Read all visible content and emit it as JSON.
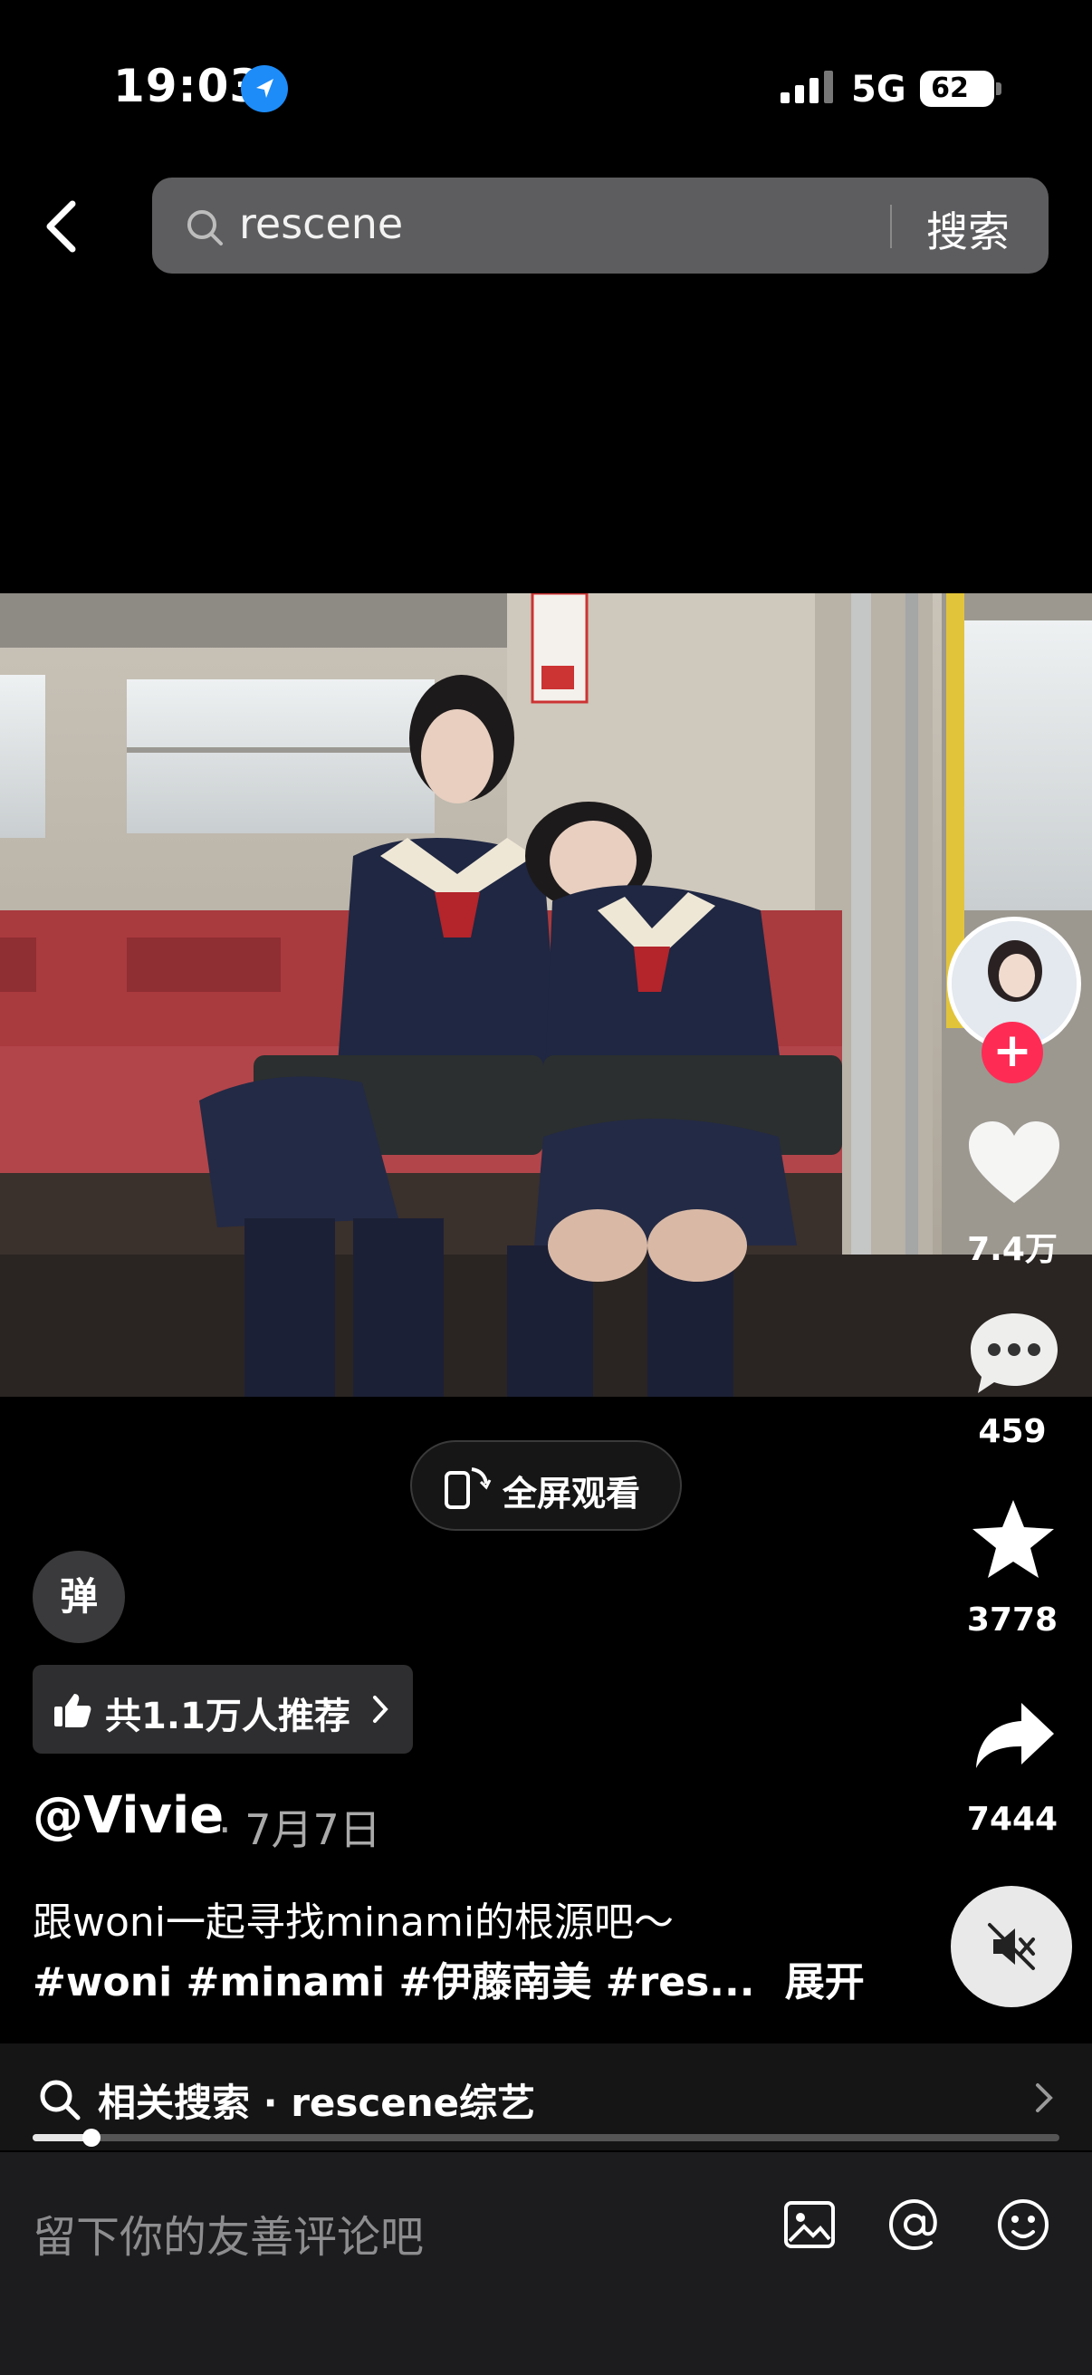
{
  "status_bar": {
    "time": "19:03",
    "network": "5G",
    "battery": "62"
  },
  "search": {
    "query": "rescene",
    "button_label": "搜索"
  },
  "actions": {
    "likes": "7.4万",
    "comments": "459",
    "favorites": "3778",
    "shares": "7444",
    "follow_label": "+"
  },
  "video": {
    "fullscreen_label": "全屏观看",
    "danmaku_label": "弹",
    "recommend_label": "共1.1万人推荐"
  },
  "post": {
    "author": "@Vivie",
    "date": "· 7月7日",
    "caption_line1": "跟woni一起寻找minami的根源吧～",
    "caption_line2": "#woni #minami #伊藤南美 #res...",
    "expand_label": "展开"
  },
  "related": {
    "label": "相关搜索 · rescene综艺"
  },
  "playback": {
    "progress": 0.057
  },
  "comment_bar": {
    "placeholder": "留下你的友善评论吧"
  },
  "colors": {
    "accent_red": "#fe2c55",
    "location_blue": "#1d8cf8"
  }
}
